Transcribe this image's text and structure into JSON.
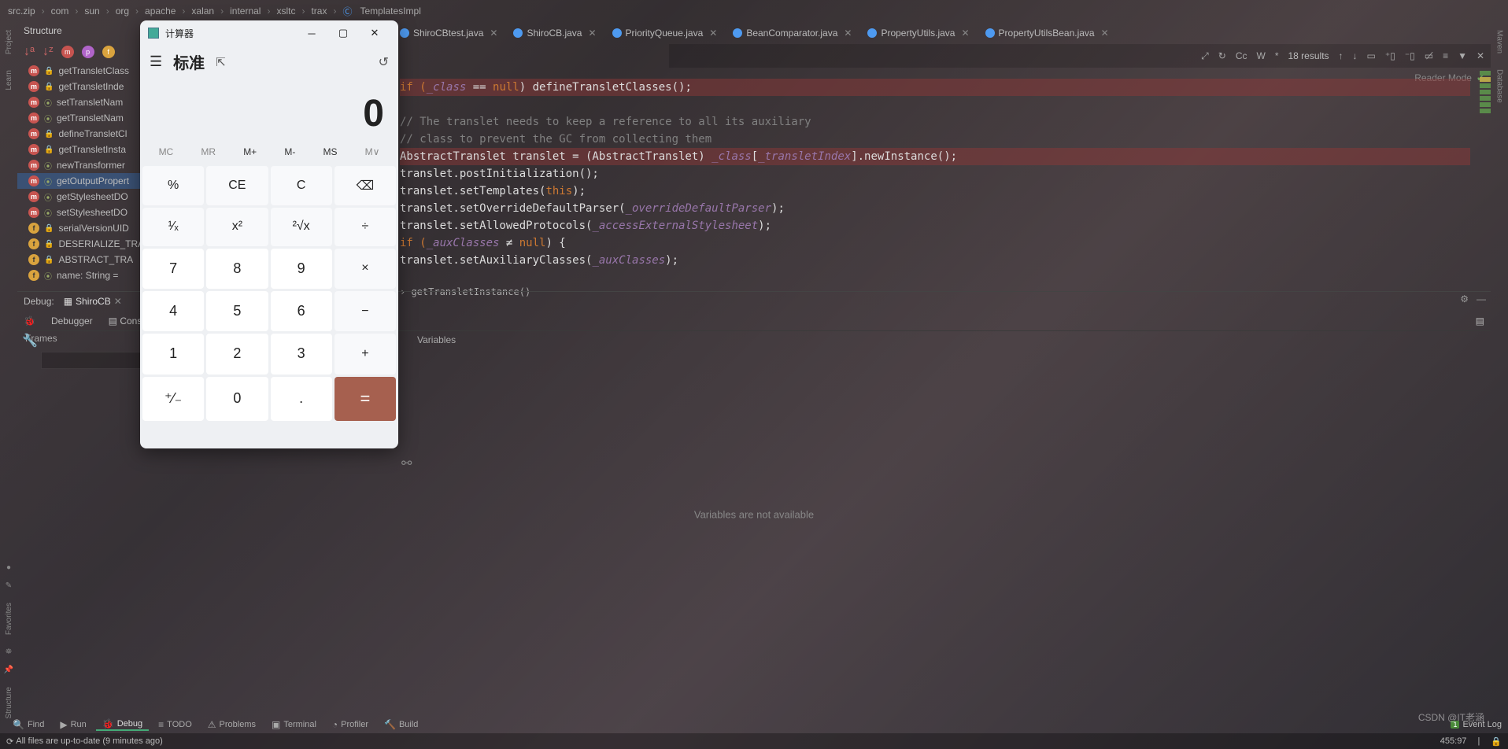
{
  "breadcrumbs": [
    "src.zip",
    "com",
    "sun",
    "org",
    "apache",
    "xalan",
    "internal",
    "xsltc",
    "trax",
    "TemplatesImpl"
  ],
  "structure": {
    "title": "Structure",
    "items": [
      {
        "kind": "m",
        "lock": true,
        "name": "getTransletClass"
      },
      {
        "kind": "m",
        "lock": true,
        "name": "getTransletInde"
      },
      {
        "kind": "m",
        "lock": false,
        "name": "setTransletNam"
      },
      {
        "kind": "m",
        "lock": false,
        "name": "getTransletNam"
      },
      {
        "kind": "m",
        "lock": true,
        "name": "defineTransletCl"
      },
      {
        "kind": "m",
        "lock": true,
        "name": "getTransletInsta"
      },
      {
        "kind": "m",
        "lock": false,
        "name": "newTransformer"
      },
      {
        "kind": "m",
        "lock": false,
        "name": "getOutputPropert",
        "selected": true
      },
      {
        "kind": "m",
        "lock": false,
        "name": "getStylesheetDO"
      },
      {
        "kind": "m",
        "lock": false,
        "name": "setStylesheetDO"
      },
      {
        "kind": "f",
        "lock": true,
        "name": "serialVersionUID"
      },
      {
        "kind": "f",
        "lock": true,
        "name": "DESERIALIZE_TRA"
      },
      {
        "kind": "f",
        "lock": true,
        "name": "ABSTRACT_TRA"
      },
      {
        "kind": "f",
        "lock": false,
        "name": "name: String ="
      }
    ]
  },
  "tabs": [
    "ShiroCBtest.java",
    "ShiroCB.java",
    "PriorityQueue.java",
    "BeanComparator.java",
    "PropertyUtils.java",
    "PropertyUtilsBean.java"
  ],
  "find": {
    "results": "18 results",
    "cc": "Cc",
    "w": "W",
    "star": "*"
  },
  "reader_mode": "Reader Mode",
  "code": {
    "l1_pre": "if (",
    "l1_fld": "_class",
    "l1_mid": " == ",
    "l1_null": "null",
    "l1_post": ") defineTransletClasses();",
    "c1": "// The translet needs to keep a reference to all its auxiliary",
    "c2": "// class to prevent the GC from collecting them",
    "l3_pre": "AbstractTranslet translet = (AbstractTranslet) ",
    "l3_fld1": "_class",
    "l3_mid": "[",
    "l3_fld2": "_transletIndex",
    "l3_post": "].newInstance();",
    "l4": "translet.postInitialization();",
    "l5_pre": "translet.setTemplates(",
    "l5_this": "this",
    "l5_post": ");",
    "l6_pre": "translet.setOverrideDefaultParser(",
    "l6_fld": "_overrideDefaultParser",
    "l6_post": ");",
    "l7_pre": "translet.setAllowedProtocols(",
    "l7_fld": "_accessExternalStylesheet",
    "l7_post": ");",
    "l8_pre": "if (",
    "l8_fld": "_auxClasses",
    "l8_mid": " ≠ ",
    "l8_null": "null",
    "l8_post": ") {",
    "l9_pre": "    translet.setAuxiliaryClasses(",
    "l9_fld": "_auxClasses",
    "l9_post": ");",
    "inline_bc": "getTransletInstance()"
  },
  "debug": {
    "label": "Debug:",
    "config": "ShiroCB",
    "sub": {
      "debugger": "Debugger",
      "console": "Cons"
    },
    "frames": "Frames",
    "variables": "Variables",
    "vars_empty": "Variables are not available"
  },
  "bottom": {
    "find": "Find",
    "run": "Run",
    "debug": "Debug",
    "todo": "TODO",
    "problems": "Problems",
    "terminal": "Terminal",
    "profiler": "Profiler",
    "build": "Build",
    "eventlog": "Event Log",
    "eventbadge": "1"
  },
  "status": {
    "msg": "All files are up-to-date (9 minutes ago)",
    "pos": "455:97"
  },
  "left_rail": {
    "project": "Project",
    "learn": "Learn",
    "favorites": "Favorites",
    "structure": "Structure"
  },
  "right_rail": {
    "maven": "Maven",
    "database": "Database"
  },
  "watermark": "CSDN @IT老涵",
  "calc": {
    "title": "计算器",
    "mode": "标准",
    "display": "0",
    "mem": [
      "MC",
      "MR",
      "M+",
      "M-",
      "MS",
      "M∨"
    ],
    "keys": [
      [
        "%",
        "CE",
        "C",
        "⌫"
      ],
      [
        "¹⁄ₓ",
        "x²",
        "²√x",
        "÷"
      ],
      [
        "7",
        "8",
        "9",
        "×"
      ],
      [
        "4",
        "5",
        "6",
        "−"
      ],
      [
        "1",
        "2",
        "3",
        "+"
      ],
      [
        "⁺⁄₋",
        "0",
        ".",
        "="
      ]
    ]
  }
}
